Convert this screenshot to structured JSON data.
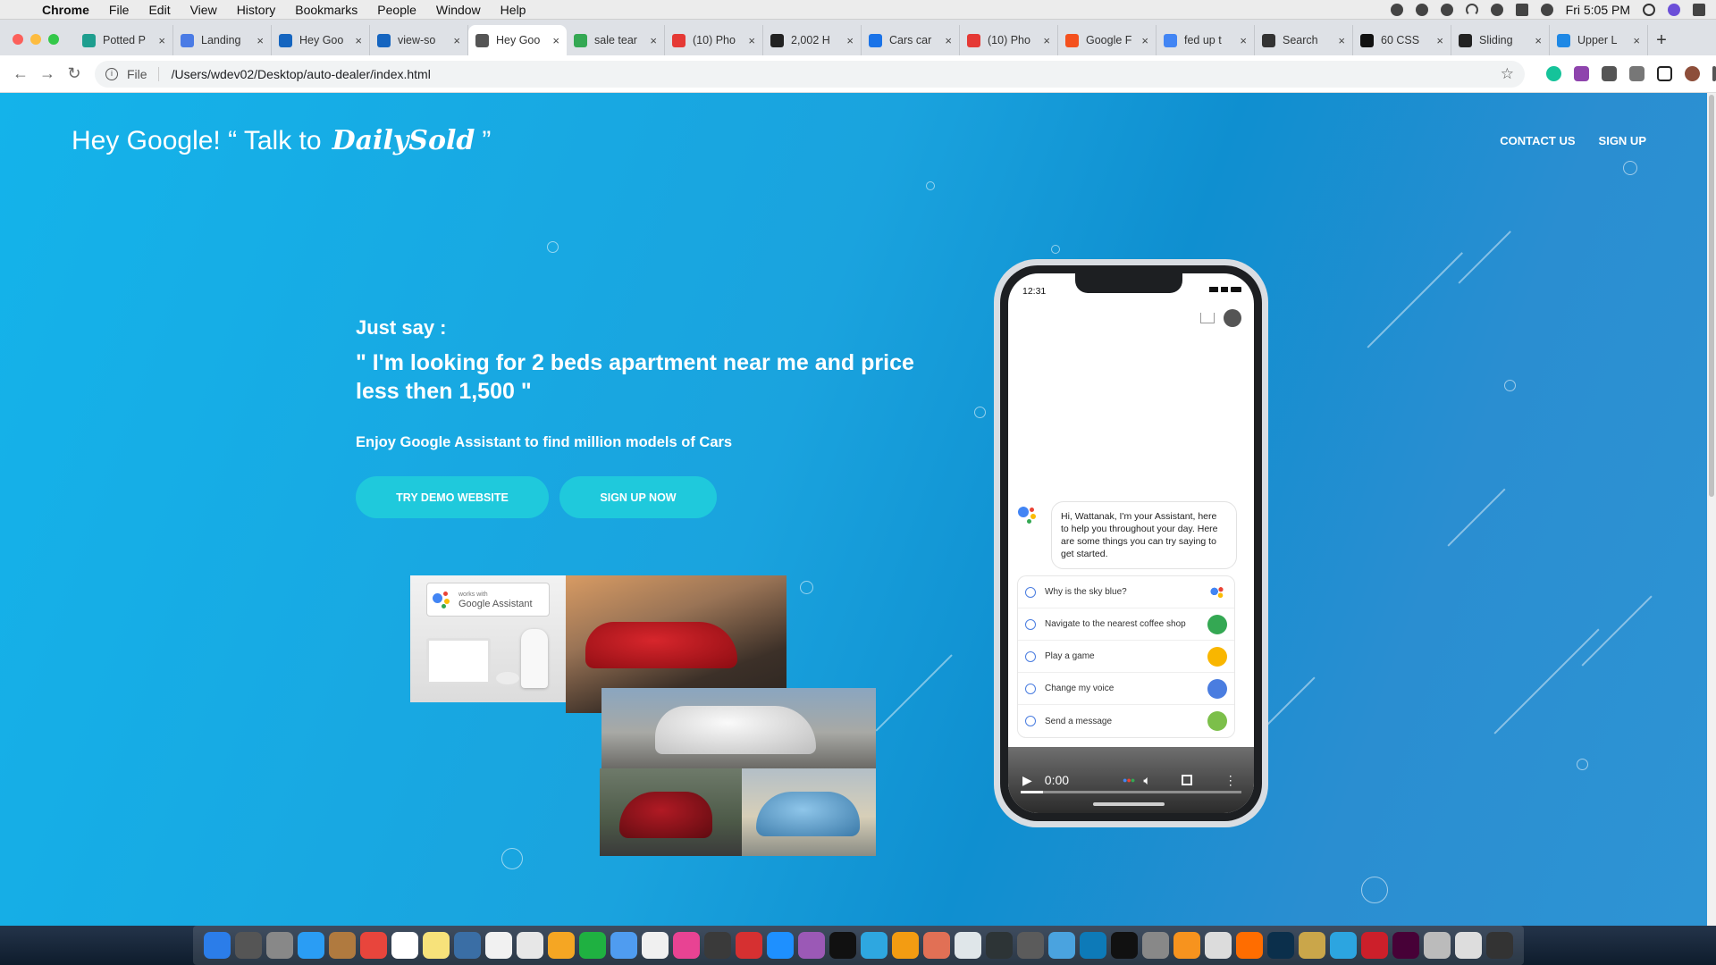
{
  "menubar": {
    "app_name": "Chrome",
    "items": [
      "File",
      "Edit",
      "View",
      "History",
      "Bookmarks",
      "People",
      "Window",
      "Help"
    ],
    "clock": "Fri 5:05 PM"
  },
  "tabs": [
    {
      "title": "Potted P",
      "fav_color": "#1e9e8f"
    },
    {
      "title": "Landing",
      "fav_color": "#4a7be5"
    },
    {
      "title": "Hey Goo",
      "fav_color": "#1565c0"
    },
    {
      "title": "view-so",
      "fav_color": "#1565c0"
    },
    {
      "title": "Hey Goo",
      "fav_color": "#555555",
      "active": true
    },
    {
      "title": "sale tear",
      "fav_color": "#34a853"
    },
    {
      "title": "(10) Pho",
      "fav_color": "#e53935"
    },
    {
      "title": "2,002 H",
      "fav_color": "#222222"
    },
    {
      "title": "Cars car",
      "fav_color": "#1a73e8"
    },
    {
      "title": "(10) Pho",
      "fav_color": "#e53935"
    },
    {
      "title": "Google F",
      "fav_color": "#f4511e"
    },
    {
      "title": "fed up t",
      "fav_color": "#4285f4"
    },
    {
      "title": "Search",
      "fav_color": "#333333"
    },
    {
      "title": "60 CSS",
      "fav_color": "#111111"
    },
    {
      "title": "Sliding",
      "fav_color": "#222222"
    },
    {
      "title": "Upper L",
      "fav_color": "#1e88e5"
    }
  ],
  "address": {
    "scheme": "File",
    "url": "/Users/wdev02/Desktop/auto-dealer/index.html"
  },
  "site": {
    "brand_prefix": "Hey Google! “ Talk to",
    "brand_logo": "DailySold",
    "brand_suffix": "”",
    "nav": {
      "contact": "CONTACT US",
      "signup": "SIGN UP"
    },
    "hero": {
      "say": "Just say :",
      "quote": "\" I'm looking for 2 beds apartment near me and price less then 1,500 \"",
      "sub": "Enjoy Google Assistant to find million models of Cars",
      "btn_demo": "TRY DEMO WEBSITE",
      "btn_signup": "SIGN UP NOW"
    },
    "photo_labels": {
      "works_with": "works with",
      "google_assistant": "Google Assistant"
    }
  },
  "phone": {
    "time": "12:31",
    "assistant_message": "Hi, Wattanak, I'm your Assistant, here to help you throughout your day. Here are some things you can try saying to get started.",
    "suggestions": [
      {
        "label": "Why is the sky blue?",
        "icon": "google-assistant-icon"
      },
      {
        "label": "Navigate to the nearest coffee shop",
        "icon": "maps-icon"
      },
      {
        "label": "Play a game",
        "icon": "pacman-icon"
      },
      {
        "label": "Change my voice",
        "icon": "person-icon"
      },
      {
        "label": "Send a message",
        "icon": "messages-icon"
      }
    ],
    "video_time": "0:00"
  }
}
